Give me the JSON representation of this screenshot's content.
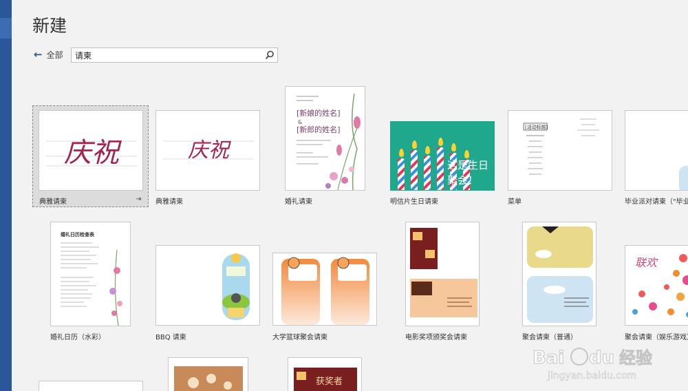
{
  "page": {
    "title": "新建"
  },
  "nav": {
    "back_label": "全部"
  },
  "search": {
    "value": "请柬",
    "placeholder": ""
  },
  "templates": [
    {
      "id": "t1",
      "name": "典雅请柬",
      "art_text": "庆祝",
      "selected": true
    },
    {
      "id": "t2",
      "name": "典雅请柬",
      "art_text": "庆祝"
    },
    {
      "id": "t3",
      "name": "婚礼请柬",
      "art_line1": "[新娘的姓名]",
      "art_amp": "&",
      "art_line2": "[新郎的姓名]"
    },
    {
      "id": "t4",
      "name": "明信片生日请柬",
      "art_line1": "这是生日",
      "art_line2": "聚会！"
    },
    {
      "id": "t5",
      "name": "菜单",
      "art_text": "[活动标题]"
    },
    {
      "id": "t6",
      "name": "毕业派对请柬（\"毕业派"
    },
    {
      "id": "t7",
      "name": "婚礼日历（水彩）",
      "art_text": "婚礼日历检查表"
    },
    {
      "id": "t8",
      "name": "BBQ 请柬"
    },
    {
      "id": "t9",
      "name": "大学篮球聚会请柬"
    },
    {
      "id": "t10",
      "name": "电影奖项颁奖会请柬"
    },
    {
      "id": "t11",
      "name": "聚会请柬（普通）"
    },
    {
      "id": "t12",
      "name": "聚会请柬（娱乐游戏）",
      "art_text": "联欢"
    },
    {
      "id": "t13",
      "name": ""
    },
    {
      "id": "t14",
      "name": ""
    },
    {
      "id": "t15",
      "name": "",
      "art_text": "获奖者"
    }
  ],
  "watermark": {
    "brand_a": "Bai",
    "brand_b": "du",
    "brand_c": "经验",
    "url": "jingyan.baidu.com"
  },
  "colors": {
    "accent": "#2b579a",
    "festive": "#a3244f",
    "teal": "#1fa88c"
  }
}
